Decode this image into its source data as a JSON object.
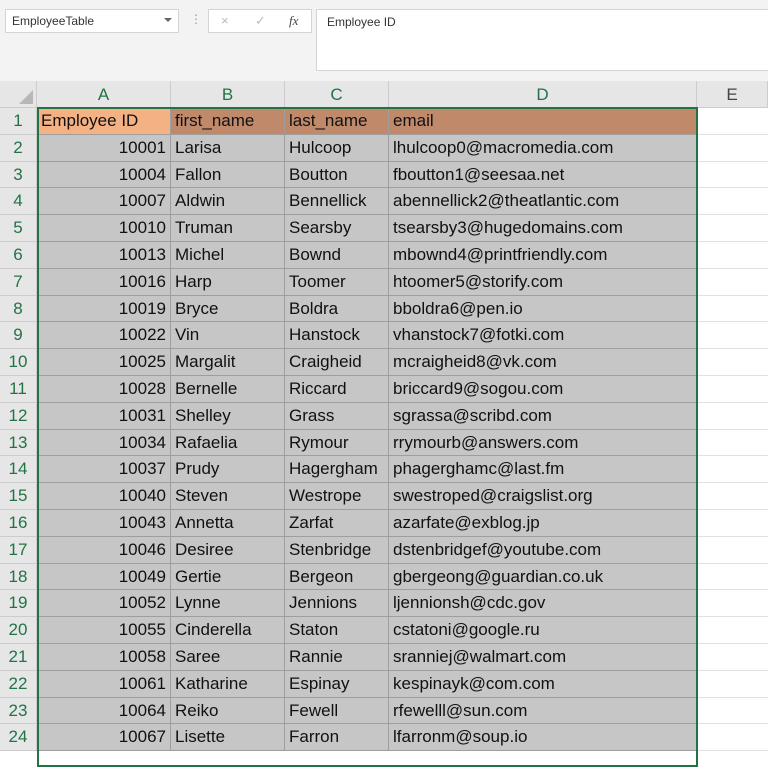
{
  "name_box": "EmployeeTable",
  "formula_bar": {
    "cancel_icon": "×",
    "enter_icon": "✓",
    "fx_label": "fx",
    "content": "Employee ID"
  },
  "columns": [
    "A",
    "B",
    "C",
    "D",
    "E"
  ],
  "headers": [
    "Employee ID",
    "first_name",
    "last_name",
    "email"
  ],
  "rows": [
    [
      "10001",
      "Larisa",
      "Hulcoop",
      "lhulcoop0@macromedia.com"
    ],
    [
      "10004",
      "Fallon",
      "Boutton",
      "fboutton1@seesaa.net"
    ],
    [
      "10007",
      "Aldwin",
      "Bennellick",
      "abennellick2@theatlantic.com"
    ],
    [
      "10010",
      "Truman",
      "Searsby",
      "tsearsby3@hugedomains.com"
    ],
    [
      "10013",
      "Michel",
      "Bownd",
      "mbownd4@printfriendly.com"
    ],
    [
      "10016",
      "Harp",
      "Toomer",
      "htoomer5@storify.com"
    ],
    [
      "10019",
      "Bryce",
      "Boldra",
      "bboldra6@pen.io"
    ],
    [
      "10022",
      "Vin",
      "Hanstock",
      "vhanstock7@fotki.com"
    ],
    [
      "10025",
      "Margalit",
      "Craigheid",
      "mcraigheid8@vk.com"
    ],
    [
      "10028",
      "Bernelle",
      "Riccard",
      "briccard9@sogou.com"
    ],
    [
      "10031",
      "Shelley",
      "Grass",
      "sgrassa@scribd.com"
    ],
    [
      "10034",
      "Rafaelia",
      "Rymour",
      "rrymourb@answers.com"
    ],
    [
      "10037",
      "Prudy",
      "Hagergham",
      "phagerghamc@last.fm"
    ],
    [
      "10040",
      "Steven",
      "Westrope",
      "swestroped@craigslist.org"
    ],
    [
      "10043",
      "Annetta",
      "Zarfat",
      "azarfate@exblog.jp"
    ],
    [
      "10046",
      "Desiree",
      "Stenbridge",
      "dstenbridgef@youtube.com"
    ],
    [
      "10049",
      "Gertie",
      "Bergeon",
      "gbergeong@guardian.co.uk"
    ],
    [
      "10052",
      "Lynne",
      "Jennions",
      "ljennionsh@cdc.gov"
    ],
    [
      "10055",
      "Cinderella",
      "Staton",
      "cstatoni@google.ru"
    ],
    [
      "10058",
      "Saree",
      "Rannie",
      "sranniej@walmart.com"
    ],
    [
      "10061",
      "Katharine",
      "Espinay",
      "kespinayk@com.com"
    ],
    [
      "10064",
      "Reiko",
      "Fewell",
      "rfewelll@sun.com"
    ],
    [
      "10067",
      "Lisette",
      "Farron",
      "lfarronm@soup.io"
    ]
  ]
}
